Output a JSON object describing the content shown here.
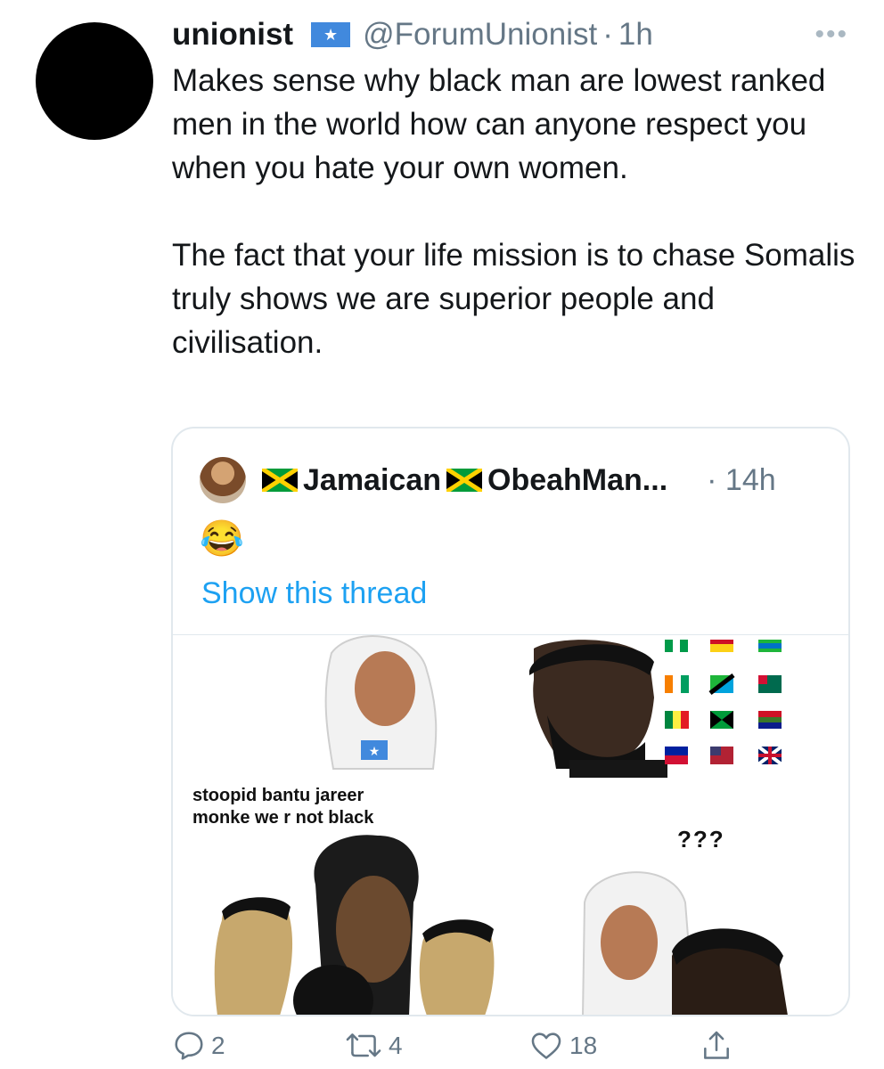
{
  "tweet": {
    "display_name": "unionist",
    "handle": "@ForumUnionist",
    "separator": "·",
    "time": "1h",
    "more_icon": "more-dots-icon",
    "text_paragraph_1": "Makes sense why black man are lowest ranked men in the world how can anyone respect you when you hate your own women.",
    "text_paragraph_2": "The fact that your life mission is to chase Somalis truly shows we are superior people and civilisation."
  },
  "quoted_tweet": {
    "display_name": "Jamaican",
    "display_name_2": "ObeahMan...",
    "time": "· 14h",
    "emoji": "😂",
    "show_thread": "Show this thread",
    "meme": {
      "caption_line_1": "stoopid bantu jareer",
      "caption_line_2": "monke we r not black",
      "question": "???"
    }
  },
  "actions": {
    "reply_count": "2",
    "retweet_count": "4",
    "like_count": "18"
  },
  "colors": {
    "link": "#1da1f2",
    "muted": "#657786",
    "border": "#e1e8ed"
  }
}
